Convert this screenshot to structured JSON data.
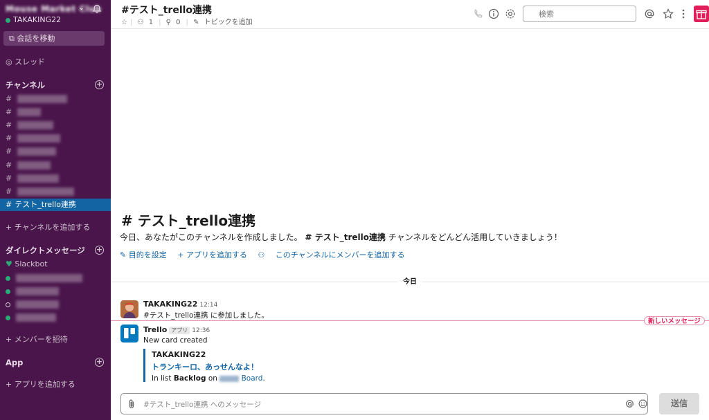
{
  "sidebar": {
    "workspace_name": "Mouse Market Club",
    "user": "TAKAKING22",
    "jump_label": "会話を移動",
    "threads_label": "スレッド",
    "channels_header": "チャンネル",
    "active_channel": "テスト_trello連携",
    "add_channel": "チャンネルを追加する",
    "dm_header": "ダイレクトメッセージ",
    "slackbot": "Slackbot",
    "invite": "メンバーを招待",
    "apps_header": "App",
    "add_app": "アプリを追加する"
  },
  "header": {
    "title": "#テスト_trello連携",
    "members": "1",
    "pins": "0",
    "add_topic": "トピックを追加",
    "search_placeholder": "検索"
  },
  "intro": {
    "title": "# テスト_trello連携",
    "text_pre": "今日、あなたがこのチャンネルを作成しました。",
    "text_channel": "# テスト_trello連携",
    "text_post": " チャンネルをどんどん活用していきましょう！",
    "link_purpose": "✎ 目的を設定",
    "link_app": "+ アプリを追加する",
    "link_member": "このチャンネルにメンバーを追加する"
  },
  "day_divider": "今日",
  "messages": [
    {
      "author": "TAKAKING22",
      "time": "12:14",
      "text": "#テスト_trello連携 に参加しました。"
    },
    {
      "author": "Trello",
      "badge": "アプリ",
      "time": "12:36",
      "text": "New card created",
      "attachment": {
        "author": "TAKAKING22",
        "title": "トランキーロ、あっせんなよ！",
        "in_list": "In list ",
        "list": "Backlog",
        "on": " on ",
        "board": "Board",
        "period": "."
      }
    }
  ],
  "new_messages_label": "新しいメッセージ",
  "composer": {
    "placeholder": "#テスト_trello連携 へのメッセージ",
    "send_label": "送信"
  },
  "colors": {
    "sidebar_bg": "#4a154b",
    "active_channel": "#1264a3",
    "link": "#1264a3",
    "new_msg": "#e01e5a"
  }
}
